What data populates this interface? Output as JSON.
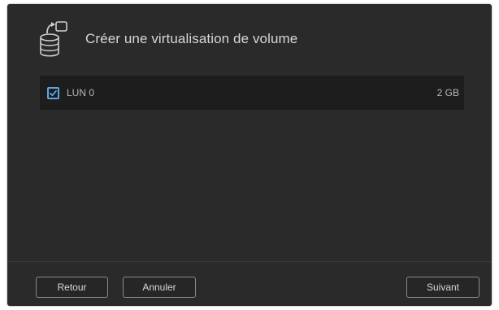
{
  "dialog": {
    "title": "Créer une virtualisation de volume",
    "header_icon": "volume-virtualization-icon"
  },
  "volumes": [
    {
      "name": "LUN 0",
      "size": "2 GB",
      "checked": true
    }
  ],
  "footer": {
    "back_label": "Retour",
    "cancel_label": "Annuler",
    "next_label": "Suivant"
  },
  "colors": {
    "dialog_bg": "#2a2a2a",
    "row_bg": "#1d1d1d",
    "accent": "#5aa6e8"
  }
}
